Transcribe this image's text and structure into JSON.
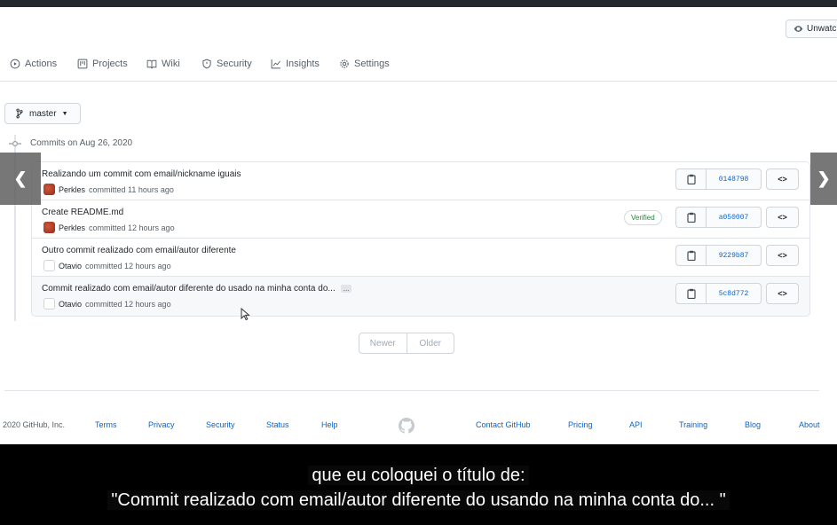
{
  "header": {
    "watch_label": "Unwatch"
  },
  "repo_nav": [
    {
      "label": "Actions",
      "icon": "play-circle-icon"
    },
    {
      "label": "Projects",
      "icon": "project-board-icon"
    },
    {
      "label": "Wiki",
      "icon": "book-icon"
    },
    {
      "label": "Security",
      "icon": "shield-icon"
    },
    {
      "label": "Insights",
      "icon": "graph-icon"
    },
    {
      "label": "Settings",
      "icon": "gear-icon"
    }
  ],
  "branch": {
    "name": "master"
  },
  "commits_header": "Commits on Aug 26, 2020",
  "commits": [
    {
      "title": "Realizando um commit com email/nickname iguais",
      "author": "Perkles",
      "time": "committed 11 hours ago",
      "sha": "0148798",
      "verified": "",
      "ellipsis": ""
    },
    {
      "title": "Create README.md",
      "author": "Perkles",
      "time": "committed 12 hours ago",
      "sha": "a050007",
      "verified": "Verified",
      "ellipsis": ""
    },
    {
      "title": "Outro commit realizado com email/autor diferente",
      "author": "Otavio",
      "time": "committed 12 hours ago",
      "sha": "9229b87",
      "verified": "",
      "ellipsis": ""
    },
    {
      "title": "Commit realizado com email/autor diferente do usado na minha conta do...",
      "author": "Otavio",
      "time": "committed 12 hours ago",
      "sha": "5c8d772",
      "verified": "",
      "ellipsis": "..."
    }
  ],
  "pager": {
    "newer": "Newer",
    "older": "Older"
  },
  "footer": {
    "copyright": "2020 GitHub, Inc.",
    "links_left": [
      "Terms",
      "Privacy",
      "Security",
      "Status",
      "Help"
    ],
    "links_right": [
      "Contact GitHub",
      "Pricing",
      "API",
      "Training",
      "Blog",
      "About"
    ]
  },
  "browse_symbol": "<>",
  "subtitles": {
    "line1": "que eu coloquei o título de:",
    "line2": "\"Commit realizado com email/autor diferente do usando na minha conta do... \""
  },
  "colors": {
    "link": "#0366d6",
    "verified": "#22863a",
    "topbar": "#24292e",
    "border": "#e1e4e8"
  }
}
